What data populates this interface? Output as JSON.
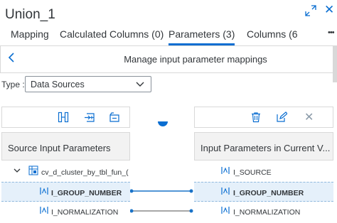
{
  "header": {
    "title": "Union_1"
  },
  "tabs": [
    {
      "label": "Mapping",
      "active": false
    },
    {
      "label": "Calculated Columns (0)",
      "active": false
    },
    {
      "label": "Parameters (3)",
      "active": true
    },
    {
      "label": "Columns (6",
      "active": false
    }
  ],
  "subheader": {
    "title": "Manage input parameter mappings"
  },
  "type_filter": {
    "label": "Type :",
    "value": "Data Sources"
  },
  "source_panel": {
    "header": "Source Input Parameters",
    "node": "cv_d_cluster_by_tbl_fun_(",
    "rows": [
      {
        "label": "I_GROUP_NUMBER",
        "selected": true
      },
      {
        "label": "I_NORMALIZATION",
        "selected": false
      }
    ]
  },
  "target_panel": {
    "header": "Input Parameters in Current V...",
    "rows": [
      {
        "label": "I_SOURCE",
        "selected": false
      },
      {
        "label": "I_GROUP_NUMBER",
        "selected": true
      },
      {
        "label": "I_NORMALIZATION",
        "selected": false
      }
    ]
  },
  "colors": {
    "accent": "#0a6ed1",
    "selected_row": "#e5f0fa",
    "header_bg": "#f2f2f2",
    "link_line": "#1a73c8"
  }
}
